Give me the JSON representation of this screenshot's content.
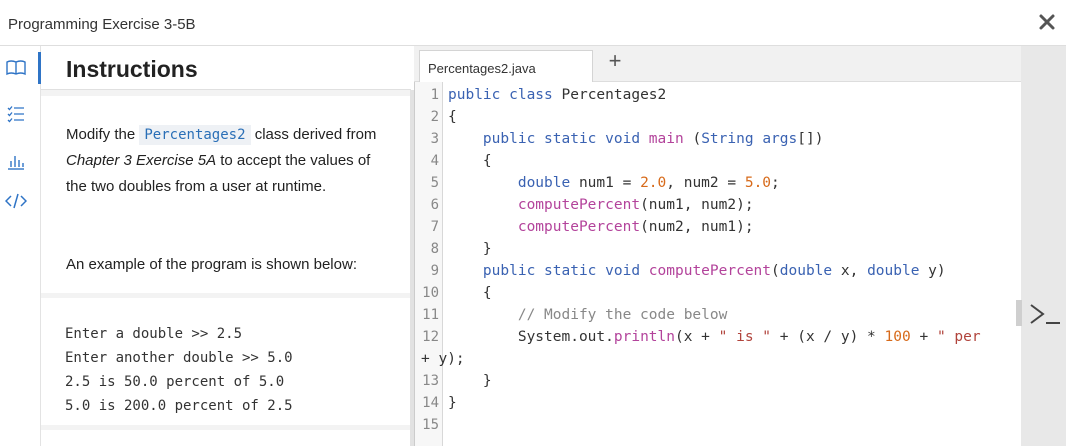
{
  "window": {
    "title": "Programming Exercise 3-5B"
  },
  "rail": {
    "icons": [
      "book-icon",
      "list-icon",
      "chart-icon",
      "code-icon"
    ]
  },
  "instructions": {
    "heading": "Instructions",
    "para1": {
      "t1": "Modify the ",
      "code": "Percentages2",
      "t2": " class derived from ",
      "italic": "Chapter 3 Exercise 5A",
      "t3": " to accept the values of the two doubles from a user at runtime."
    },
    "para2": "An example of the program is shown below:",
    "example": [
      "Enter a double >> 2.5",
      "Enter another double >> 5.0",
      "2.5 is 50.0 percent of 5.0",
      "5.0 is 200.0 percent of 2.5"
    ]
  },
  "editor": {
    "tab": "Percentages2.java",
    "add_tab": "+",
    "lines": [
      {
        "n": "1",
        "tokens": [
          [
            "kw",
            "public class "
          ],
          [
            "pl",
            "Percentages2"
          ]
        ]
      },
      {
        "n": "2",
        "tokens": [
          [
            "pl",
            "{"
          ]
        ]
      },
      {
        "n": "3",
        "tokens": [
          [
            "kw",
            "    public static void "
          ],
          [
            "fn",
            "main"
          ],
          [
            "pl",
            " ("
          ],
          [
            "ty",
            "String"
          ],
          [
            "pl",
            " "
          ],
          [
            "kw",
            "args"
          ],
          [
            "pl",
            "[])"
          ]
        ]
      },
      {
        "n": "4",
        "tokens": [
          [
            "pl",
            "    {"
          ]
        ]
      },
      {
        "n": "5",
        "tokens": [
          [
            "kw",
            "        double "
          ],
          [
            "pl",
            "num1 = "
          ],
          [
            "num",
            "2.0"
          ],
          [
            "pl",
            ", num2 = "
          ],
          [
            "num",
            "5.0"
          ],
          [
            "pl",
            ";"
          ]
        ]
      },
      {
        "n": "6",
        "tokens": [
          [
            "fn",
            "        computePercent"
          ],
          [
            "pl",
            "(num1, num2);"
          ]
        ]
      },
      {
        "n": "7",
        "tokens": [
          [
            "fn",
            "        computePercent"
          ],
          [
            "pl",
            "(num2, num1);"
          ]
        ]
      },
      {
        "n": "8",
        "tokens": [
          [
            "pl",
            "    }"
          ]
        ]
      },
      {
        "n": "9",
        "tokens": [
          [
            "kw",
            "    public static void "
          ],
          [
            "fn",
            "computePercent"
          ],
          [
            "pl",
            "("
          ],
          [
            "kw",
            "double "
          ],
          [
            "pl",
            "x, "
          ],
          [
            "kw",
            "double "
          ],
          [
            "pl",
            "y)"
          ]
        ]
      },
      {
        "n": "10",
        "tokens": [
          [
            "pl",
            "    {"
          ]
        ]
      },
      {
        "n": "11",
        "tokens": [
          [
            "cm",
            "        // Modify the code below"
          ]
        ]
      },
      {
        "n": "12",
        "tokens": [
          [
            "pl",
            "        System.out."
          ],
          [
            "fn",
            "println"
          ],
          [
            "pl",
            "(x + "
          ],
          [
            "str",
            "\" is \""
          ],
          [
            "pl",
            " + (x / y) * "
          ],
          [
            "num",
            "100"
          ],
          [
            "pl",
            " + "
          ],
          [
            "str",
            "\" per"
          ]
        ]
      },
      {
        "n": "",
        "tokens": [
          [
            "pl",
            "+ y);"
          ]
        ]
      },
      {
        "n": "13",
        "tokens": [
          [
            "pl",
            "    }"
          ]
        ]
      },
      {
        "n": "14",
        "tokens": [
          [
            "pl",
            "}"
          ]
        ]
      },
      {
        "n": "15",
        "tokens": []
      }
    ]
  },
  "colors": {
    "accent": "#2f74c6"
  }
}
